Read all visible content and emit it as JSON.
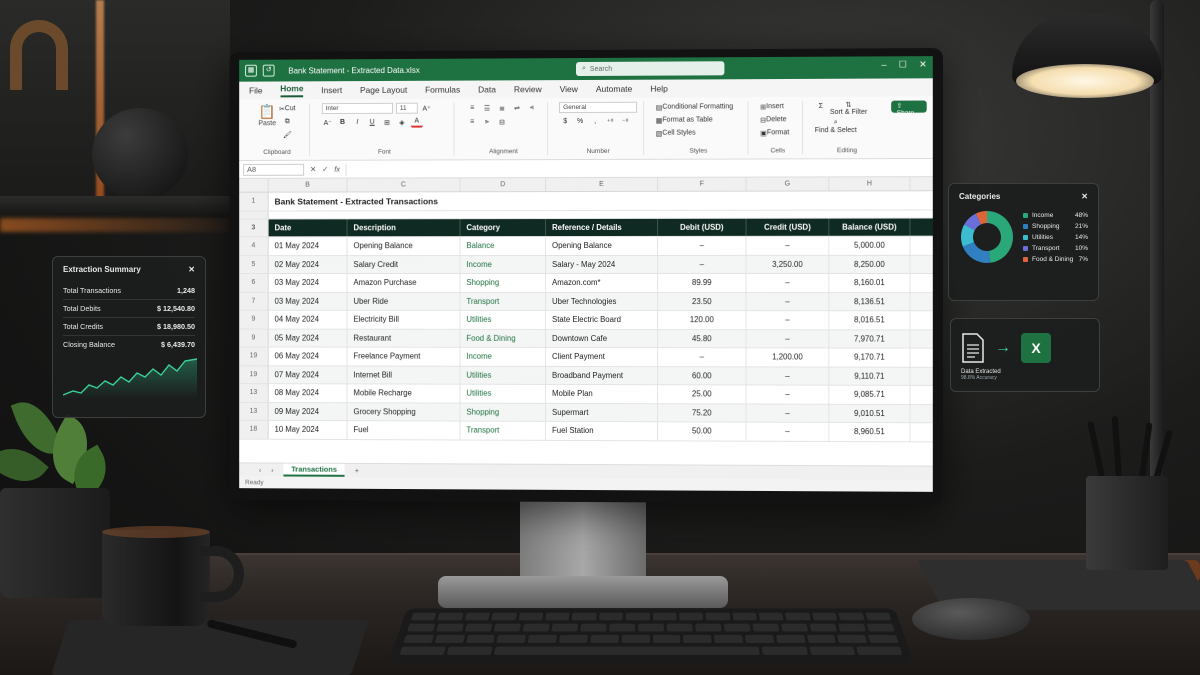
{
  "window": {
    "title": "Bank Statement - Extracted Data.xlsx",
    "search_placeholder": "Search",
    "share_label": "Share"
  },
  "menu": [
    "File",
    "Home",
    "Insert",
    "Page Layout",
    "Formulas",
    "Data",
    "Review",
    "View",
    "Automate",
    "Help"
  ],
  "ribbon": {
    "clipboard": {
      "name": "Clipboard",
      "paste": "Paste",
      "cut": "Cut"
    },
    "font": {
      "name": "Font",
      "family": "Inter",
      "size": "11"
    },
    "alignment": {
      "name": "Alignment"
    },
    "number": {
      "name": "Number",
      "format": "General"
    },
    "styles": {
      "name": "Styles",
      "items": [
        "Conditional Formatting",
        "Format as Table",
        "Cell Styles"
      ]
    },
    "cells": {
      "name": "Cells",
      "items": [
        "Insert",
        "Delete",
        "Format"
      ]
    },
    "editing": {
      "name": "Editing",
      "sort": "Sort & Filter",
      "find": "Find & Select"
    }
  },
  "formula_bar": {
    "name_box": "A8",
    "fx": "fx"
  },
  "columns": [
    "B",
    "C",
    "D",
    "E",
    "F",
    "G",
    "H",
    "I"
  ],
  "sheet": {
    "title": "Bank Statement - Extracted Transactions",
    "title_row": "1",
    "header_row": "3",
    "headers": [
      "Date",
      "Description",
      "Category",
      "Reference / Details",
      "Debit (USD)",
      "Credit (USD)",
      "Balance (USD)"
    ],
    "rows": [
      {
        "n": "4",
        "date": "01 May 2024",
        "desc": "Opening Balance",
        "cat": "Balance",
        "ref": "Opening Balance",
        "debit": "–",
        "credit": "–",
        "bal": "5,000.00"
      },
      {
        "n": "5",
        "date": "02 May 2024",
        "desc": "Salary Credit",
        "cat": "Income",
        "ref": "Salary - May 2024",
        "debit": "–",
        "credit": "3,250.00",
        "bal": "8,250.00"
      },
      {
        "n": "6",
        "date": "03 May 2024",
        "desc": "Amazon Purchase",
        "cat": "Shopping",
        "ref": "Amazon.com*",
        "debit": "89.99",
        "credit": "–",
        "bal": "8,160.01"
      },
      {
        "n": "7",
        "date": "03 May 2024",
        "desc": "Uber Ride",
        "cat": "Transport",
        "ref": "Uber Technologies",
        "debit": "23.50",
        "credit": "–",
        "bal": "8,136.51"
      },
      {
        "n": "9",
        "date": "04 May 2024",
        "desc": "Electricity Bill",
        "cat": "Utilities",
        "ref": "State Electric Board",
        "debit": "120.00",
        "credit": "–",
        "bal": "8,016.51"
      },
      {
        "n": "9",
        "date": "05 May 2024",
        "desc": "Restaurant",
        "cat": "Food & Dining",
        "ref": "Downtown Cafe",
        "debit": "45.80",
        "credit": "–",
        "bal": "7,970.71"
      },
      {
        "n": "19",
        "date": "06 May 2024",
        "desc": "Freelance Payment",
        "cat": "Income",
        "ref": "Client Payment",
        "debit": "–",
        "credit": "1,200.00",
        "bal": "9,170.71"
      },
      {
        "n": "19",
        "date": "07 May 2024",
        "desc": "Internet Bill",
        "cat": "Utilities",
        "ref": "Broadband Payment",
        "debit": "60.00",
        "credit": "–",
        "bal": "9,110.71"
      },
      {
        "n": "13",
        "date": "08 May 2024",
        "desc": "Mobile Recharge",
        "cat": "Utilities",
        "ref": "Mobile Plan",
        "debit": "25.00",
        "credit": "–",
        "bal": "9,085.71"
      },
      {
        "n": "13",
        "date": "09 May 2024",
        "desc": "Grocery Shopping",
        "cat": "Shopping",
        "ref": "Supermart",
        "debit": "75.20",
        "credit": "–",
        "bal": "9,010.51"
      },
      {
        "n": "18",
        "date": "10 May 2024",
        "desc": "Fuel",
        "cat": "Transport",
        "ref": "Fuel Station",
        "debit": "50.00",
        "credit": "–",
        "bal": "8,960.51"
      }
    ]
  },
  "sheet_tabs": {
    "active": "Transactions",
    "add": "+"
  },
  "status": "Ready",
  "summary_card": {
    "title": "Extraction Summary",
    "rows": [
      {
        "label": "Total Transactions",
        "value": "1,248"
      },
      {
        "label": "Total Debits",
        "value": "$ 12,540.80"
      },
      {
        "label": "Total Credits",
        "value": "$ 18,980.50"
      },
      {
        "label": "Closing Balance",
        "value": "$ 6,439.70"
      }
    ]
  },
  "categories_card": {
    "title": "Categories",
    "items": [
      {
        "name": "Income",
        "pct": "48%",
        "value": 48,
        "color": "#2aa87a"
      },
      {
        "name": "Shopping",
        "pct": "21%",
        "value": 21,
        "color": "#2f7fc1"
      },
      {
        "name": "Utilities",
        "pct": "14%",
        "value": 14,
        "color": "#3bbcd0"
      },
      {
        "name": "Transport",
        "pct": "10%",
        "value": 10,
        "color": "#6a6fd8"
      },
      {
        "name": "Food & Dining",
        "pct": "7%",
        "value": 7,
        "color": "#e0643a"
      }
    ]
  },
  "extract_card": {
    "label": "Data Extracted",
    "sub": "98.8% Accuracy",
    "excel_letter": "X"
  },
  "colors": {
    "excel_green": "#1e7140",
    "header_dark": "#0f2a22"
  }
}
